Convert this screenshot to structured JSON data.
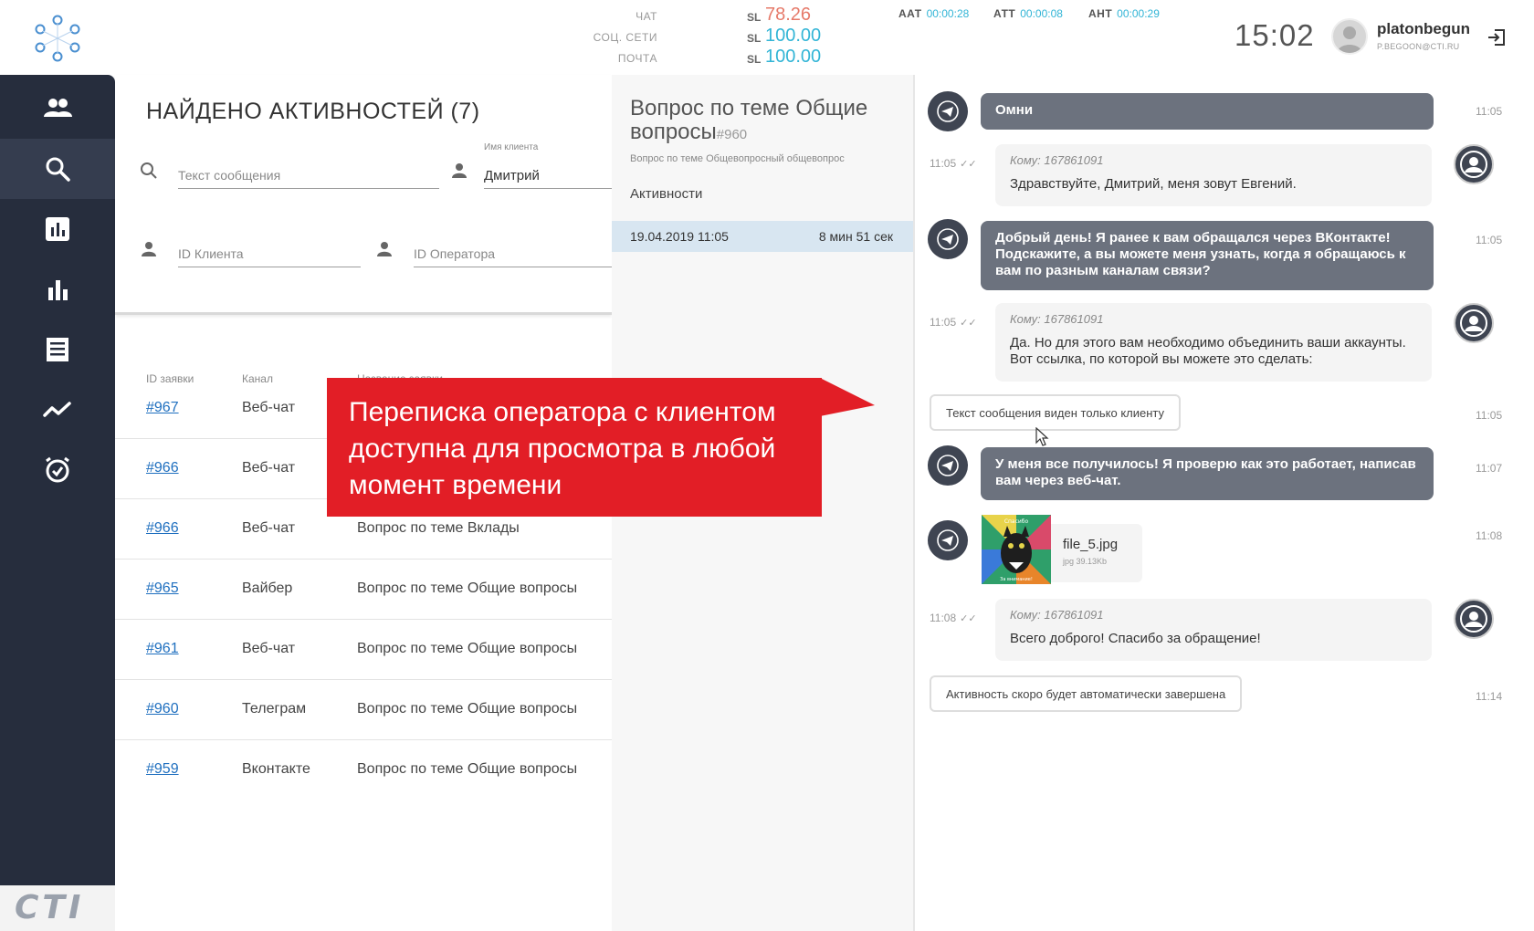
{
  "header": {
    "stats": [
      {
        "label": "ЧАТ",
        "sl": "SL",
        "value": "78.26",
        "color": "#e67a6a"
      },
      {
        "label": "СОЦ. СЕТИ",
        "sl": "SL",
        "value": "100.00",
        "color": "#33b5d6"
      },
      {
        "label": "ПОЧТА",
        "sl": "SL",
        "value": "100.00",
        "color": "#33b5d6"
      }
    ],
    "timers": [
      {
        "label": "ААТ",
        "value": "00:00:28"
      },
      {
        "label": "АТТ",
        "value": "00:00:08"
      },
      {
        "label": "АНТ",
        "value": "00:00:29"
      }
    ],
    "clock": "15:02",
    "user": {
      "name": "platonbegun",
      "email": "P.BEGOON@CTI.RU"
    }
  },
  "sidebar": {
    "items": [
      {
        "icon": "users-icon"
      },
      {
        "icon": "search-icon",
        "active": true
      },
      {
        "icon": "report-icon"
      },
      {
        "icon": "bar-chart-icon"
      },
      {
        "icon": "list-icon"
      },
      {
        "icon": "trend-icon"
      },
      {
        "icon": "alarm-icon"
      }
    ],
    "brand": "CTI"
  },
  "search": {
    "title": "НАЙДЕНО АКТИВНОСТЕЙ (7)",
    "message_placeholder": "Текст сообщения",
    "client_name_label": "Имя клиента",
    "client_name_value": "Дмитрий",
    "client_id_placeholder": "ID Клиента",
    "operator_id_placeholder": "ID Оператора"
  },
  "table": {
    "headers": [
      "ID заявки",
      "Канал",
      "Название заявки"
    ],
    "rows": [
      {
        "id": "#967",
        "channel": "Веб-чат",
        "name": ""
      },
      {
        "id": "#966",
        "channel": "Веб-чат",
        "name": ""
      },
      {
        "id": "#966",
        "channel": "Веб-чат",
        "name": "Вопрос по теме Вклады"
      },
      {
        "id": "#965",
        "channel": "Вайбер",
        "name": "Вопрос по теме Общие вопросы"
      },
      {
        "id": "#961",
        "channel": "Веб-чат",
        "name": "Вопрос по теме Общие вопросы"
      },
      {
        "id": "#960",
        "channel": "Телеграм",
        "name": "Вопрос по теме Общие вопросы"
      },
      {
        "id": "#959",
        "channel": "Вконтакте",
        "name": "Вопрос по теме Общие вопросы"
      }
    ]
  },
  "detail": {
    "title": "Вопрос по теме Общие вопросы",
    "number": "#960",
    "subtitle": "Вопрос по теме Общевопросный общевопрос",
    "activities_label": "Активности",
    "activity": {
      "date": "19.04.2019 11:05",
      "duration": "8 мин 51 сек"
    }
  },
  "chat": {
    "messages": [
      {
        "type": "in",
        "text": "Омни",
        "time": "11:05"
      },
      {
        "type": "out",
        "to": "Кому: 167861091",
        "text": "Здравствуйте, Дмитрий, меня зовут Евгений.",
        "time": "11:05"
      },
      {
        "type": "in",
        "text": "Добрый день! Я ранее к вам обращался через ВКонтакте! Подскажите, а вы можете меня узнать, когда я обращаюсь к вам по разным каналам связи?",
        "time": "11:05"
      },
      {
        "type": "out",
        "to": "Кому: 167861091",
        "text": "Да. Но для этого вам необходимо объединить ваши аккаунты. Вот ссылка, по которой вы можете это сделать:",
        "time": "11:05"
      },
      {
        "type": "system",
        "text": "Текст сообщения виден только клиенту",
        "time": "11:05"
      },
      {
        "type": "in",
        "text": "У меня все получилось! Я проверю как это работает, написав вам через веб-чат.",
        "time": "11:07"
      },
      {
        "type": "file",
        "name": "file_5.jpg",
        "meta": "jpg    39.13Kb",
        "thumb_caption": "Спасибо",
        "thumb_caption2": "За внимание!",
        "time": "11:08"
      },
      {
        "type": "out",
        "to": "Кому: 167861091",
        "text": "Всего доброго! Спасибо за обращение!",
        "time": "11:08"
      },
      {
        "type": "system",
        "text": "Активность скоро будет автоматически завершена",
        "time": "11:14"
      }
    ]
  },
  "callout": {
    "text": "Переписка оператора с клиентом доступна для просмотра в любой момент времени",
    "color": "#e21e26"
  }
}
